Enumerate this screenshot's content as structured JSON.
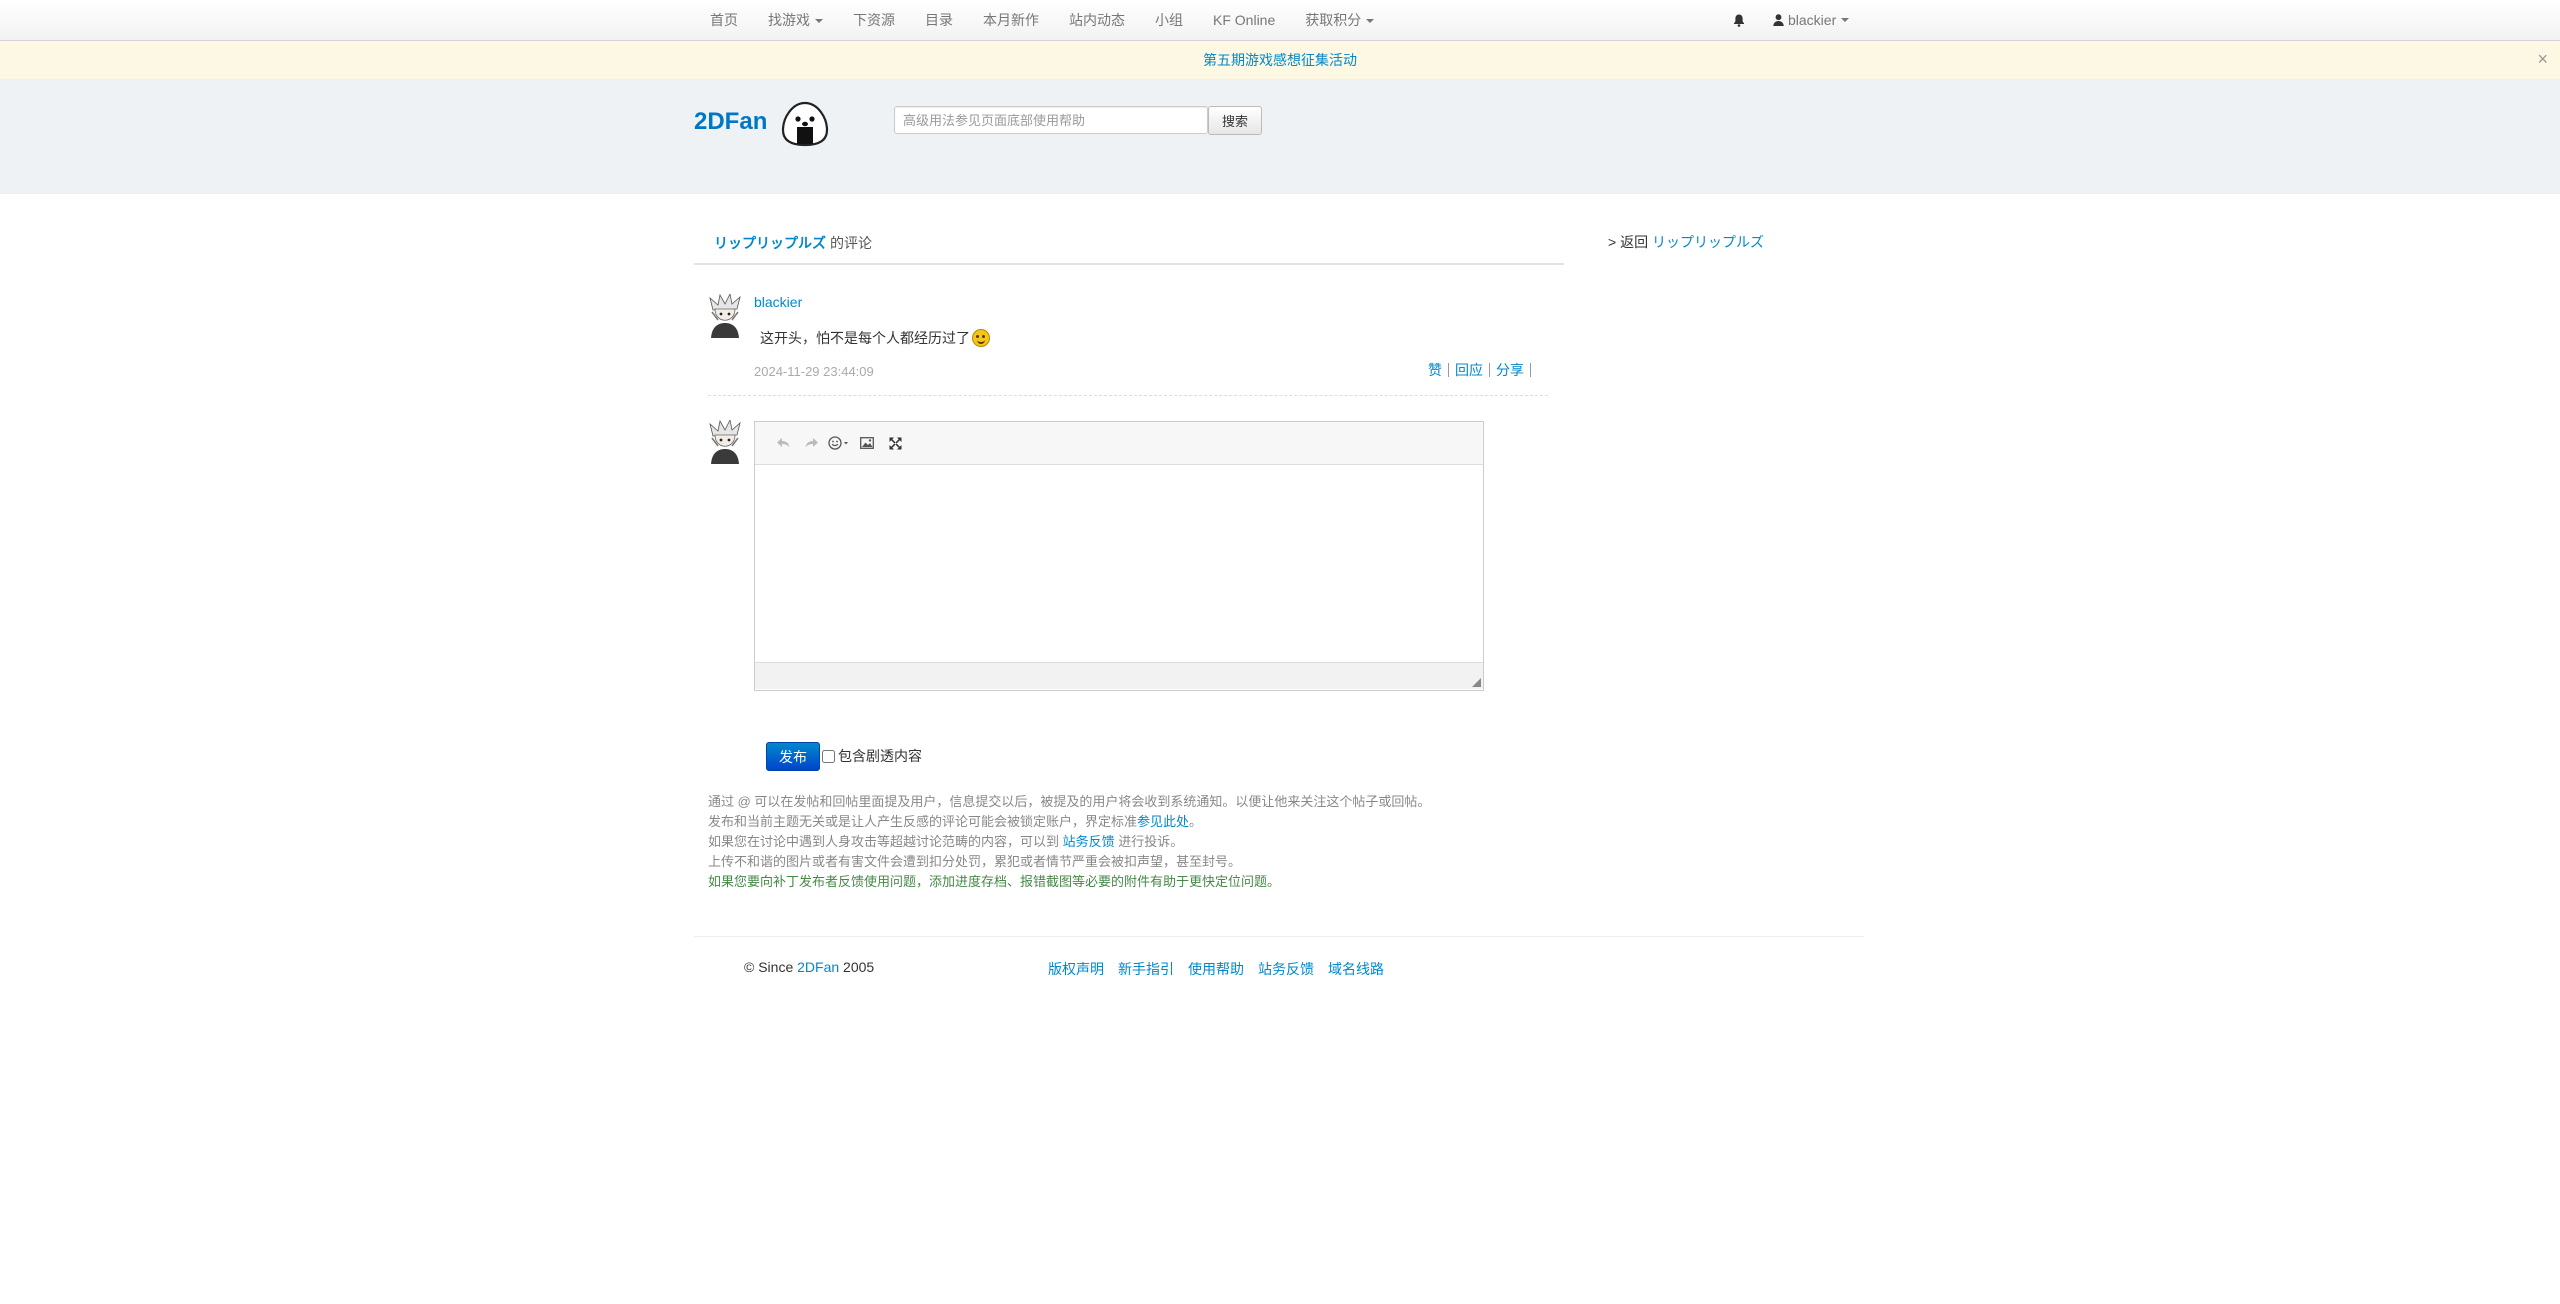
{
  "navbar": {
    "items": [
      {
        "label": "首页"
      },
      {
        "label": "找游戏"
      },
      {
        "label": "下资源"
      },
      {
        "label": "目录"
      },
      {
        "label": "本月新作"
      },
      {
        "label": "站内动态"
      },
      {
        "label": "小组"
      },
      {
        "label": "KF Online"
      },
      {
        "label": "获取积分"
      }
    ],
    "user": "blackier"
  },
  "notice": {
    "text": "第五期游戏感想征集活动",
    "close": "×"
  },
  "header": {
    "logo": "2DFan",
    "search_placeholder": "高级用法参见页面底部使用帮助",
    "search_button": "搜索"
  },
  "main": {
    "game_title": "リップリップルズ",
    "title_suffix": "的评论"
  },
  "sidebar": {
    "back_prefix": "> 返回",
    "back_link": "リップリップルズ"
  },
  "comment": {
    "user": "blackier",
    "text": "这开头，怕不是每个人都经历过了",
    "time": "2024-11-29 23:44:09",
    "actions": {
      "like": "赞",
      "reply": "回应",
      "share": "分享"
    }
  },
  "editor": {
    "publish": "发布",
    "spoiler_label": "包含剧透内容"
  },
  "help": {
    "line1": "通过 @ 可以在发帖和回帖里面提及用户，信息提交以后，被提及的用户将会收到系统通知。以便让他来关注这个帖子或回帖。",
    "line2_pre": "发布和当前主题无关或是让人产生反感的评论可能会被锁定账户，界定标准",
    "line2_link": "参见此处",
    "line2_post": "。",
    "line3_pre": "如果您在讨论中遇到人身攻击等超越讨论范畴的内容，可以到",
    "line3_link": "站务反馈",
    "line3_post": "进行投诉。",
    "line4": "上传不和谐的图片或者有害文件会遭到扣分处罚，累犯或者情节严重会被扣声望，甚至封号。",
    "line5": "如果您要向补丁发布者反馈使用问题，添加进度存档、报错截图等必要的附件有助于更快定位问题。"
  },
  "footer": {
    "since": "© Since",
    "brand": "2DFan",
    "year": "2005",
    "links": [
      "版权声明",
      "新手指引",
      "使用帮助",
      "站务反馈",
      "域名线路"
    ]
  }
}
